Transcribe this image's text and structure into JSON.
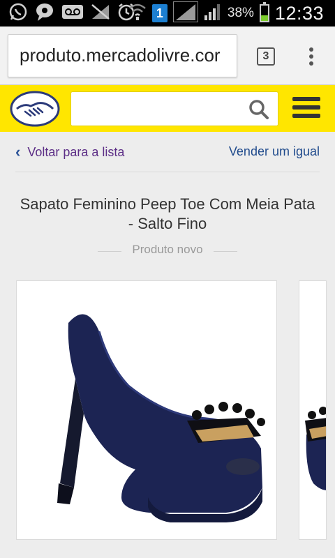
{
  "status_bar": {
    "battery_text": "38%",
    "time": "12:33",
    "sim_badge": "1",
    "battery_level": 0.38,
    "battery_color": "#7ccb2e"
  },
  "browser": {
    "url": "produto.mercadolivre.cor",
    "tab_count": "3"
  },
  "header": {
    "brand_color": "#ffe600",
    "search_placeholder": ""
  },
  "nav": {
    "back_label": "Voltar para a lista",
    "sell_label": "Vender um igual"
  },
  "product": {
    "title": "Sapato Feminino Peep Toe Com Meia Pata - Salto Fino",
    "condition": "Produto novo"
  }
}
